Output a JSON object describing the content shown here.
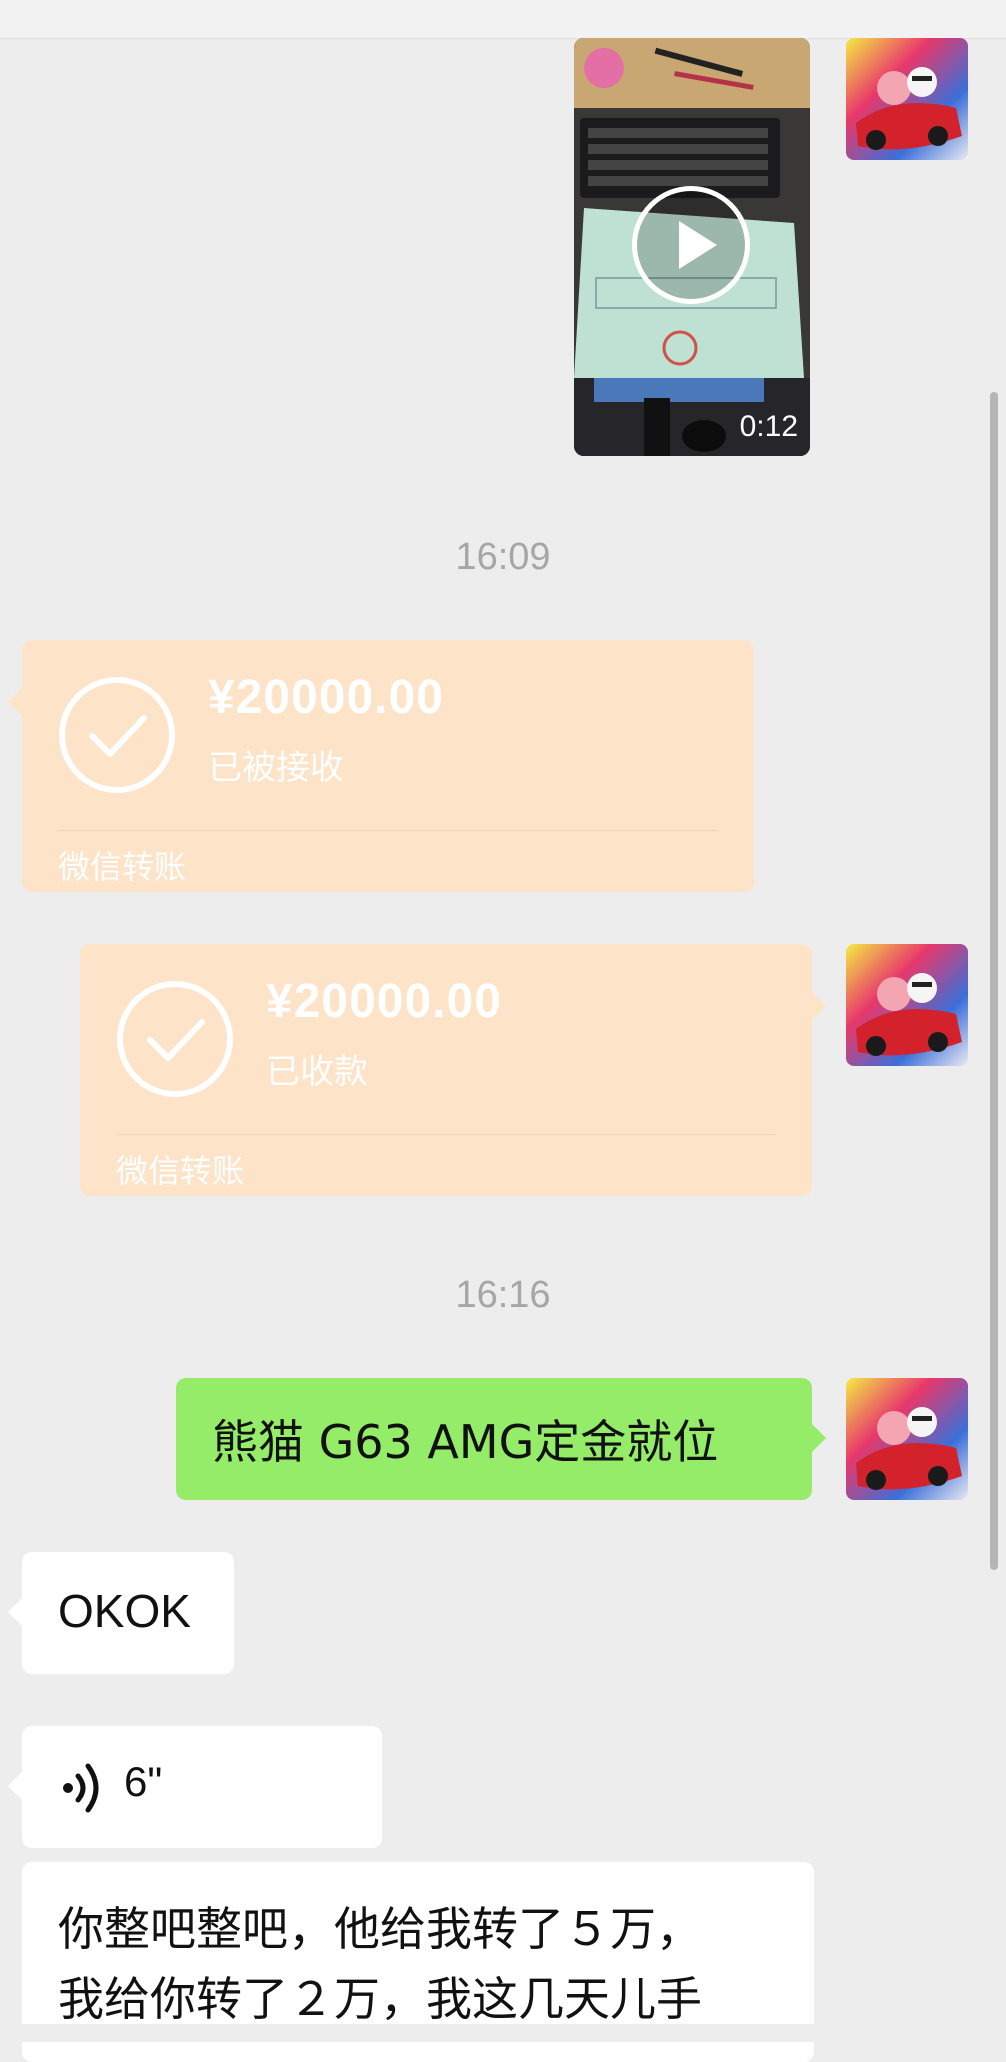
{
  "colors": {
    "background": "#ededed",
    "transfer": "#fde3c7",
    "sent_bubble": "#95ec69",
    "received_bubble": "#ffffff",
    "timestamp": "#a6a6a6"
  },
  "video_message": {
    "duration": "0:12",
    "icon": "play-icon"
  },
  "time_1": "16:09",
  "transfer_received": {
    "amount": "¥20000.00",
    "status": "已被接收",
    "footer": "微信转账",
    "icon": "check-circle-icon"
  },
  "transfer_sent": {
    "amount": "¥20000.00",
    "status": "已收款",
    "footer": "微信转账",
    "icon": "check-circle-icon"
  },
  "time_2": "16:16",
  "msg_sent": "熊猫 G63 AMG定金就位",
  "msg_okok": "OKOK",
  "voice_message": {
    "duration": "6\"",
    "icon": "voice-wave-icon"
  },
  "msg_long": {
    "line1": "你整吧整吧，他给我转了５万，",
    "line2": "我给你转了２万，我这几天儿手"
  }
}
